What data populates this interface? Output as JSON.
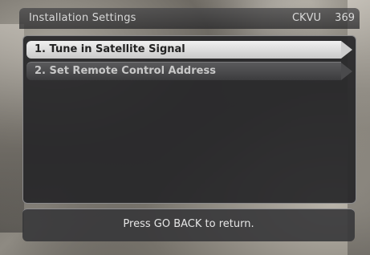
{
  "header": {
    "title": "Installation Settings",
    "channel_name": "CKVU",
    "channel_number": "369"
  },
  "menu": {
    "items": [
      {
        "label": "1. Tune in Satellite Signal",
        "selected": true
      },
      {
        "label": "2. Set Remote Control Address",
        "selected": false
      }
    ]
  },
  "footer": {
    "hint": "Press GO BACK to return."
  }
}
